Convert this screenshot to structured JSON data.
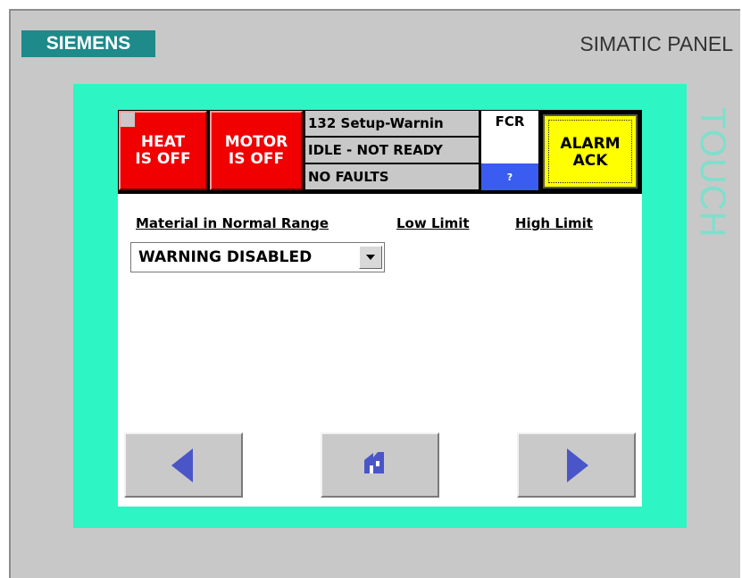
{
  "device": {
    "brand": "SIEMENS",
    "model": "SIMATIC PANEL",
    "touch_label": "TOUCH"
  },
  "status_bar": {
    "heat": "HEAT\nIS OFF",
    "motor": "MOTOR\nIS OFF",
    "messages": [
      "132 Setup-Warnin",
      "IDLE - NOT READY",
      "NO FAULTS"
    ],
    "fcr": "FCR",
    "help": "?",
    "alarm_ack": "ALARM\nACK"
  },
  "table": {
    "headers": {
      "material": "Material in Normal Range",
      "low": "Low Limit",
      "high": "High Limit"
    },
    "dropdown_value": "WARNING  DISABLED"
  },
  "nav": {
    "back_icon": "left-arrow-icon",
    "home_icon": "home-icon",
    "forward_icon": "right-arrow-icon"
  },
  "colors": {
    "bezel": "#2ef5c4",
    "alarm_on": "#f00000",
    "alarm_ack": "#ffff00",
    "help": "#3a5cf0",
    "logo": "#1e8a8a"
  }
}
